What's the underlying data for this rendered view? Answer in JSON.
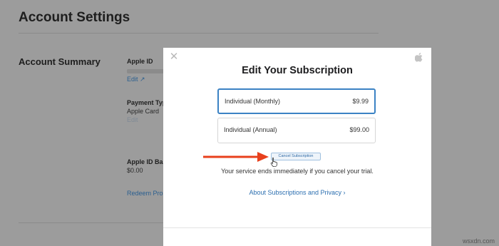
{
  "page": {
    "title": "Account Settings",
    "section_title": "Account Summary",
    "apple_id_label": "Apple ID",
    "apple_id_edit": "Edit ↗",
    "payment_type_label": "Payment Typ",
    "payment_type_value": "Apple Card",
    "payment_edit": "Edit",
    "balance_label": "Apple ID Bal",
    "balance_value": "$0.00",
    "redeem_link": "Redeem Pron"
  },
  "modal": {
    "title": "Edit Your Subscription",
    "close_icon": "close-icon",
    "brand_icon": "apple-icon",
    "plans": [
      {
        "name": "Individual (Monthly)",
        "price": "$9.99",
        "selected": true
      },
      {
        "name": "Individual (Annual)",
        "price": "$99.00",
        "selected": false
      }
    ],
    "cancel_button": "Cancel Subscription",
    "trial_note": "Your service ends immediately if you cancel your trial.",
    "about_link": "About Subscriptions and Privacy ›"
  },
  "annotation": {
    "arrow_color": "#e8401c"
  },
  "watermark": "wsxdn.com",
  "colors": {
    "accent": "#3b82c4",
    "link": "#2c6fb0",
    "overlay": "#9c9c9c"
  }
}
